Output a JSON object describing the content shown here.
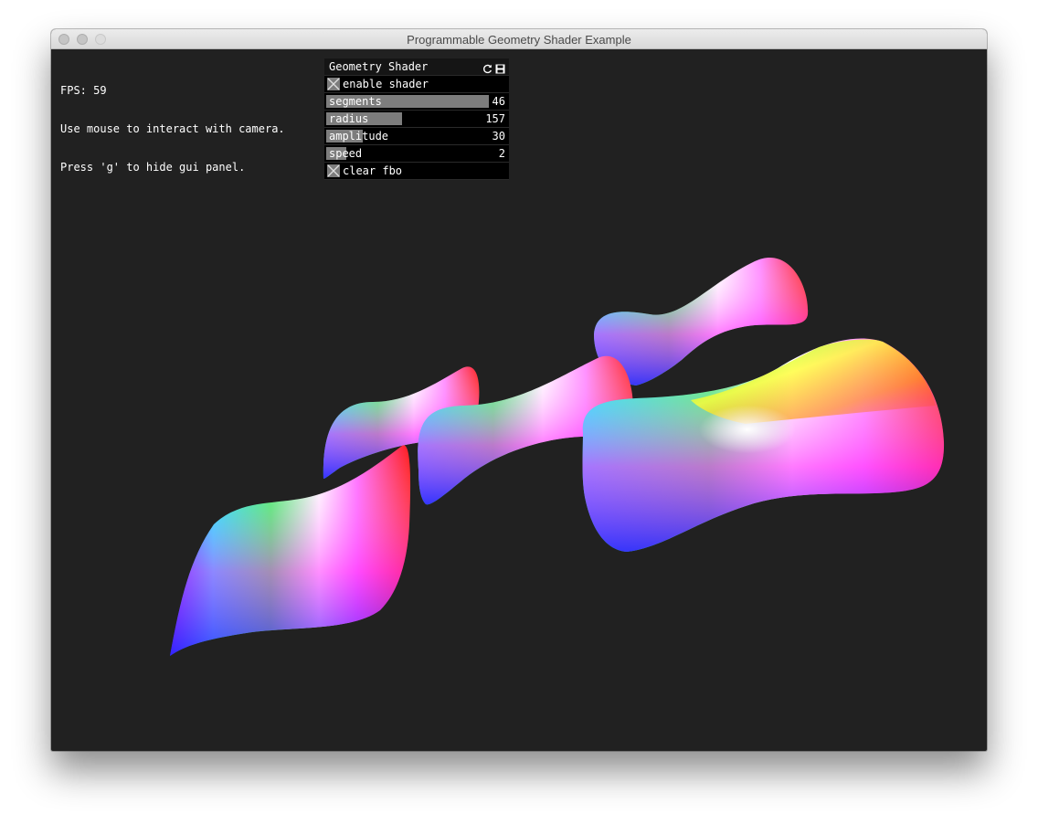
{
  "window": {
    "title": "Programmable Geometry Shader Example"
  },
  "hud": {
    "lines": [
      "FPS: 59",
      "Use mouse to interact with camera.",
      "Press 'g' to hide gui panel."
    ]
  },
  "gui": {
    "title": "Geometry Shader",
    "header_icons": [
      "refresh-icon",
      "save-icon"
    ],
    "enable_shader": {
      "label": "enable shader",
      "checked": true
    },
    "sliders": [
      {
        "label": "segments",
        "value": "46",
        "fraction": 0.9
      },
      {
        "label": "radius",
        "value": "157",
        "fraction": 0.42
      },
      {
        "label": "amplitude",
        "value": "30",
        "fraction": 0.2
      },
      {
        "label": "speed",
        "value": "2",
        "fraction": 0.11
      }
    ],
    "clear_fbo": {
      "label": "clear fbo",
      "checked": true
    }
  },
  "colors": {
    "background": "#212121",
    "gui_background": "#000000",
    "gui_fill": "#7d7d7d",
    "text": "#ffffff"
  }
}
